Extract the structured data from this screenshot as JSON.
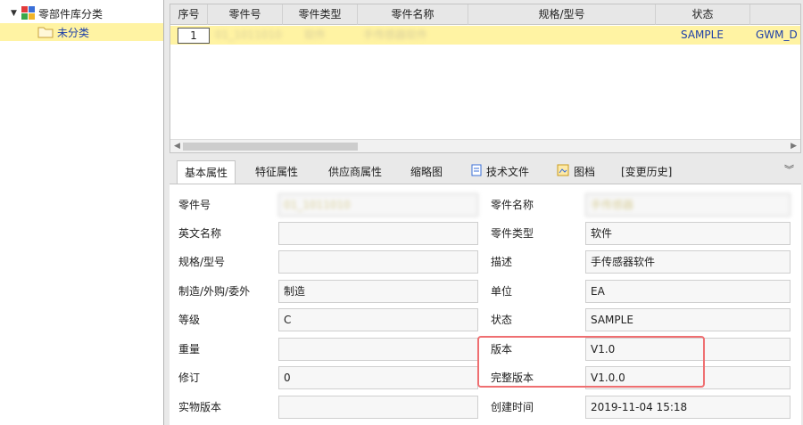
{
  "tree": {
    "root_label": "零部件库分类",
    "child_label": "未分类"
  },
  "grid": {
    "columns": [
      "序号",
      "零件号",
      "零件类型",
      "零件名称",
      "规格/型号",
      "状态"
    ],
    "row": {
      "seq": "1",
      "part_no": "01_1011010",
      "part_type": "软件",
      "part_name": "手传感器软件",
      "spec": "",
      "status": "SAMPLE",
      "extra": "GWM_D"
    }
  },
  "tabs": [
    "基本属性",
    "特征属性",
    "供应商属性",
    "缩略图",
    "技术文件",
    "图档",
    "[变更历史]"
  ],
  "form": {
    "left": [
      {
        "label": "零件号",
        "value": "01_1011010"
      },
      {
        "label": "英文名称",
        "value": ""
      },
      {
        "label": "规格/型号",
        "value": ""
      },
      {
        "label": "制造/外购/委外",
        "value": "制造"
      },
      {
        "label": "等级",
        "value": "C"
      },
      {
        "label": "重量",
        "value": ""
      },
      {
        "label": "修订",
        "value": "0"
      },
      {
        "label": "实物版本",
        "value": ""
      }
    ],
    "right": [
      {
        "label": "零件名称",
        "value": "手传感器"
      },
      {
        "label": "零件类型",
        "value": "软件"
      },
      {
        "label": "描述",
        "value": "手传感器软件"
      },
      {
        "label": "单位",
        "value": "EA"
      },
      {
        "label": "状态",
        "value": "SAMPLE"
      },
      {
        "label": "版本",
        "value": "V1.0"
      },
      {
        "label": "完整版本",
        "value": "V1.0.0"
      },
      {
        "label": "创建时间",
        "value": "2019-11-04 15:18"
      }
    ]
  },
  "colors": {
    "selection": "#fff3a3",
    "link": "#1d3fa8",
    "highlight_box": "#ef6f71"
  }
}
